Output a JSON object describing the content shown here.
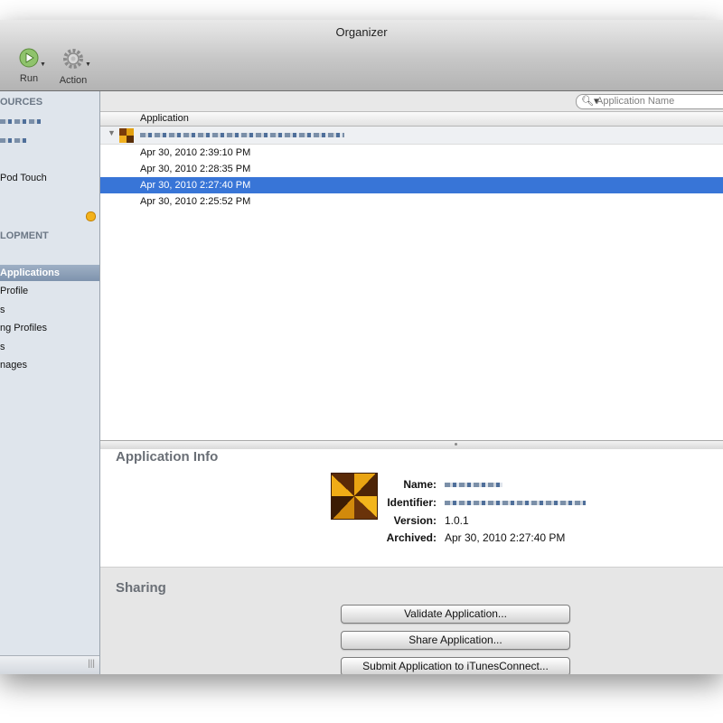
{
  "window": {
    "title": "Organizer"
  },
  "toolbar": {
    "run_label": "Run",
    "action_label": "Action"
  },
  "sidebar": {
    "devices_header": "OURCES",
    "device_item": "Pod Touch",
    "development_header": "LOPMENT",
    "items": [
      {
        "label": "Applications",
        "selected": true
      },
      {
        "label": "Profile"
      },
      {
        "label": "s"
      },
      {
        "label": "ng Profiles"
      },
      {
        "label": "s"
      },
      {
        "label": "nages"
      }
    ],
    "resize_glyph": "|||"
  },
  "search": {
    "placeholder": "Application Name"
  },
  "list": {
    "column_header": "Application",
    "rows": [
      {
        "date": "Apr 30, 2010 2:39:10 PM"
      },
      {
        "date": "Apr 30, 2010 2:28:35 PM"
      },
      {
        "date": "Apr 30, 2010 2:27:40 PM",
        "selected": true
      },
      {
        "date": "Apr 30, 2010 2:25:52 PM"
      }
    ]
  },
  "app_info": {
    "title": "Application Info",
    "name_label": "Name:",
    "identifier_label": "Identifier:",
    "version_label": "Version:",
    "version_value": "1.0.1",
    "archived_label": "Archived:",
    "archived_value": "Apr 30, 2010 2:27:40 PM"
  },
  "sharing": {
    "title": "Sharing",
    "validate_label": "Validate Application...",
    "share_label": "Share Application...",
    "submit_label": "Submit Application to iTunesConnect..."
  },
  "colors": {
    "selection": "#3875d7",
    "sidebar_bg": "#dfe5ec"
  }
}
